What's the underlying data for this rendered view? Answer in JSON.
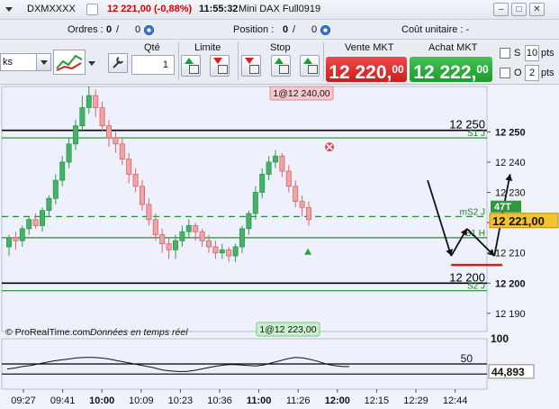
{
  "titlebar": {
    "instrument": "DXMXXXX",
    "price_change": "12 221,00 (-0,88%)",
    "time": "11:55:32",
    "contract": "Mini DAX Full0919"
  },
  "inforow": {
    "orders_label": "Ordres :",
    "orders_value": "0",
    "orders_value2": "0",
    "position_label": "Position :",
    "position_value": "0",
    "position_value2": "0",
    "unit_cost": "Coût unitaire : -"
  },
  "toolbar": {
    "timeframe_value": "ks",
    "qty_label": "Qté",
    "qty_value": "1",
    "limit_label": "Limite",
    "stop_label": "Stop",
    "sell_label": "Vente MKT",
    "sell_price_main": "12 220,",
    "sell_price_dec": "00",
    "buy_label": "Achat MKT",
    "buy_price_main": "12 222,",
    "buy_price_dec": "00",
    "s_label": "S",
    "s_value": "10",
    "s_unit": "pts",
    "o_label": "O",
    "o_value": "2",
    "o_unit": "pts",
    "colors": {
      "sell": "#e03333",
      "buy": "#2fae3f"
    }
  },
  "chart_data": [
    {
      "type": "candlestick",
      "title": "",
      "price_axis": [
        12250,
        12240,
        12230,
        12220,
        12210,
        12200,
        12190
      ],
      "y_range": [
        12184,
        12265
      ],
      "time_axis": [
        "09:27",
        "09:41",
        "10:00",
        "10:09",
        "10:23",
        "10:36",
        "11:00",
        "11:26",
        "12:00",
        "12:15",
        "12:29",
        "12:44"
      ],
      "last_price": "12 221,00",
      "last_value": 12221,
      "levels": [
        {
          "value": 12250.5,
          "color": "#000000",
          "style": "solid",
          "label": "12 250"
        },
        {
          "value": 12248,
          "color": "#1f8f2f",
          "style": "solid",
          "label": "S1 J"
        },
        {
          "value": 12222,
          "color": "#1f8f2f",
          "style": "dashed",
          "label": "mS2 J"
        },
        {
          "value": 12215,
          "color": "#1f8f2f",
          "style": "solid",
          "label": "S1 H"
        },
        {
          "value": 12200,
          "color": "#000000",
          "style": "solid",
          "label": "12 200"
        },
        {
          "value": 12197.5,
          "color": "#1f8f2f",
          "style": "solid",
          "label": "S2 J"
        }
      ],
      "tag_47T": "47T",
      "order_tags": [
        {
          "label": "1@12 240,00",
          "value": 12240,
          "time_index": 6.4
        },
        {
          "label": "1@12 223,00",
          "value": 12223,
          "time_index": 6.1
        }
      ],
      "watermark": "© ProRealTime.com",
      "realtime_label": "Données en temps réel",
      "candles": [
        {
          "o": 12212,
          "c": 12215,
          "h": 12216,
          "l": 12209
        },
        {
          "o": 12215,
          "c": 12214,
          "h": 12217,
          "l": 12211
        },
        {
          "o": 12214,
          "c": 12218,
          "h": 12219,
          "l": 12212
        },
        {
          "o": 12218,
          "c": 12221,
          "h": 12222,
          "l": 12216
        },
        {
          "o": 12221,
          "c": 12219,
          "h": 12223,
          "l": 12218
        },
        {
          "o": 12219,
          "c": 12224,
          "h": 12225,
          "l": 12217
        },
        {
          "o": 12224,
          "c": 12228,
          "h": 12229,
          "l": 12222
        },
        {
          "o": 12228,
          "c": 12234,
          "h": 12236,
          "l": 12226
        },
        {
          "o": 12234,
          "c": 12240,
          "h": 12242,
          "l": 12232
        },
        {
          "o": 12240,
          "c": 12246,
          "h": 12248,
          "l": 12238
        },
        {
          "o": 12246,
          "c": 12252,
          "h": 12254,
          "l": 12244
        },
        {
          "o": 12252,
          "c": 12258,
          "h": 12262,
          "l": 12250
        },
        {
          "o": 12258,
          "c": 12262,
          "h": 12265,
          "l": 12256
        },
        {
          "o": 12262,
          "c": 12258,
          "h": 12264,
          "l": 12255
        },
        {
          "o": 12258,
          "c": 12252,
          "h": 12260,
          "l": 12250
        },
        {
          "o": 12252,
          "c": 12248,
          "h": 12254,
          "l": 12245
        },
        {
          "o": 12248,
          "c": 12246,
          "h": 12250,
          "l": 12243
        },
        {
          "o": 12246,
          "c": 12241,
          "h": 12248,
          "l": 12239
        },
        {
          "o": 12241,
          "c": 12236,
          "h": 12243,
          "l": 12233
        },
        {
          "o": 12236,
          "c": 12232,
          "h": 12238,
          "l": 12230
        },
        {
          "o": 12232,
          "c": 12226,
          "h": 12234,
          "l": 12224
        },
        {
          "o": 12226,
          "c": 12221,
          "h": 12228,
          "l": 12219
        },
        {
          "o": 12221,
          "c": 12216,
          "h": 12223,
          "l": 12214
        },
        {
          "o": 12216,
          "c": 12213,
          "h": 12218,
          "l": 12210
        },
        {
          "o": 12213,
          "c": 12211,
          "h": 12215,
          "l": 12208
        },
        {
          "o": 12211,
          "c": 12214,
          "h": 12216,
          "l": 12208
        },
        {
          "o": 12214,
          "c": 12217,
          "h": 12219,
          "l": 12212
        },
        {
          "o": 12217,
          "c": 12219,
          "h": 12221,
          "l": 12215
        },
        {
          "o": 12219,
          "c": 12217,
          "h": 12220,
          "l": 12214
        },
        {
          "o": 12217,
          "c": 12214,
          "h": 12218,
          "l": 12212
        },
        {
          "o": 12214,
          "c": 12212,
          "h": 12216,
          "l": 12210
        },
        {
          "o": 12212,
          "c": 12210,
          "h": 12214,
          "l": 12208
        },
        {
          "o": 12210,
          "c": 12211,
          "h": 12213,
          "l": 12208
        },
        {
          "o": 12211,
          "c": 12209,
          "h": 12212,
          "l": 12207
        },
        {
          "o": 12209,
          "c": 12212,
          "h": 12213,
          "l": 12207
        },
        {
          "o": 12212,
          "c": 12218,
          "h": 12219,
          "l": 12210
        },
        {
          "o": 12218,
          "c": 12223,
          "h": 12224,
          "l": 12216
        },
        {
          "o": 12223,
          "c": 12230,
          "h": 12232,
          "l": 12221
        },
        {
          "o": 12230,
          "c": 12236,
          "h": 12238,
          "l": 12228
        },
        {
          "o": 12236,
          "c": 12240,
          "h": 12242,
          "l": 12234
        },
        {
          "o": 12240,
          "c": 12242,
          "h": 12244,
          "l": 12238
        },
        {
          "o": 12242,
          "c": 12237,
          "h": 12243,
          "l": 12235
        },
        {
          "o": 12237,
          "c": 12232,
          "h": 12239,
          "l": 12230
        },
        {
          "o": 12232,
          "c": 12227,
          "h": 12234,
          "l": 12225
        },
        {
          "o": 12227,
          "c": 12225,
          "h": 12229,
          "l": 12222
        },
        {
          "o": 12225,
          "c": 12221,
          "h": 12227,
          "l": 12219
        }
      ],
      "annotations": {
        "arrows": [
          {
            "x0": 10.3,
            "y0": 12234,
            "x1": 10.9,
            "y1": 12209
          },
          {
            "x0": 10.9,
            "y0": 12209,
            "x1": 11.3,
            "y1": 12218
          },
          {
            "x0": 11.3,
            "y0": 12218,
            "x1": 12.0,
            "y1": 12209
          },
          {
            "x0": 12.0,
            "y0": 12209,
            "x1": 12.4,
            "y1": 12236
          }
        ],
        "red_line": {
          "x0": 10.9,
          "x1": 12.2,
          "y": 12206
        }
      }
    },
    {
      "type": "line",
      "title": "",
      "axis": [
        100,
        50
      ],
      "value_label": "44,893",
      "last_value": 44.893,
      "y_range": [
        0,
        100
      ],
      "ref_lines": [
        {
          "value": 50
        },
        {
          "value": 30
        }
      ],
      "values": [
        40,
        42,
        45,
        47,
        50,
        53,
        56,
        58,
        60,
        62,
        63,
        63,
        62,
        60,
        57,
        54,
        51,
        48,
        45,
        42,
        38,
        36,
        35,
        35,
        37,
        40,
        43,
        46,
        48,
        49,
        48,
        47,
        46,
        48,
        52,
        56,
        60,
        63,
        62,
        59,
        55,
        50,
        47,
        45,
        44.9
      ]
    }
  ]
}
